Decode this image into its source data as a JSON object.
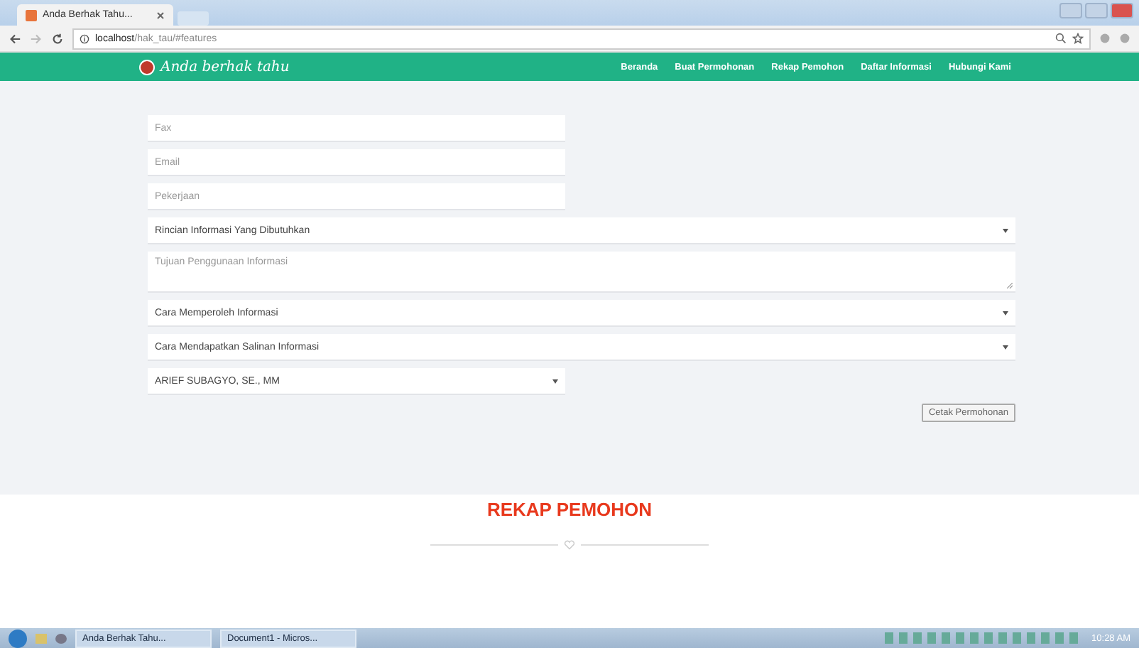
{
  "browser": {
    "tab_title": "Anda Berhak Tahu...",
    "url_host": "localhost",
    "url_path": "/hak_tau/#features"
  },
  "navbar": {
    "brand": "Anda berhak tahu",
    "items": [
      {
        "label": "Beranda"
      },
      {
        "label": "Buat Permohonan"
      },
      {
        "label": "Rekap Pemohon"
      },
      {
        "label": "Daftar Informasi"
      },
      {
        "label": "Hubungi Kami"
      }
    ]
  },
  "contact_fields": [
    {
      "kind": "input",
      "placeholder": "Fax"
    },
    {
      "kind": "input",
      "placeholder": "Email"
    },
    {
      "kind": "input",
      "placeholder": "Pekerjaan"
    }
  ],
  "request_fields": [
    {
      "kind": "select",
      "value": "Rincian Informasi Yang Dibutuhkan"
    },
    {
      "kind": "textarea",
      "placeholder": "Tujuan Penggunaan Informasi"
    },
    {
      "kind": "select",
      "value": "Cara Memperoleh Informasi"
    },
    {
      "kind": "select",
      "value": "Cara Mendapatkan Salinan Informasi"
    }
  ],
  "officer_select": {
    "value": "ARIEF SUBAGYO, SE., MM"
  },
  "print_button": "Cetak Permohonan",
  "section_title": "REKAP PEMOHON",
  "taskbar": {
    "items": [
      {
        "label": "Anda Berhak Tahu..."
      },
      {
        "label": "Document1 - Micros..."
      }
    ],
    "clock": "10:28 AM"
  }
}
